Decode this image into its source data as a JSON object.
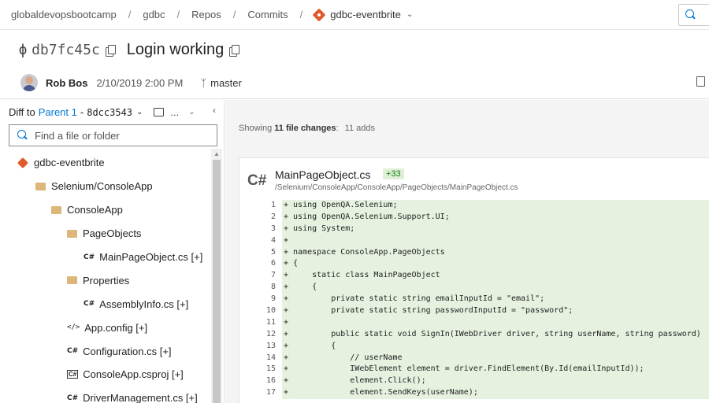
{
  "breadcrumb": {
    "items": [
      "globaldevopsbootcamp",
      "gdbc",
      "Repos",
      "Commits"
    ],
    "separator": "/",
    "repo": "gdbc-eventbrite"
  },
  "commit": {
    "hash": "db7fc45c",
    "title": "Login working",
    "author": "Rob Bos",
    "date": "2/10/2019 2:00 PM",
    "branch": "master"
  },
  "diff": {
    "prefix": "Diff to",
    "parent": "Parent 1",
    "dash": "-",
    "parent_hash": "8dcc3543",
    "more": "..."
  },
  "filter": {
    "placeholder": "Find a file or folder"
  },
  "tree": [
    {
      "label": "gdbc-eventbrite",
      "icon": "repo",
      "indent": 0
    },
    {
      "label": "Selenium/ConsoleApp",
      "icon": "folder",
      "indent": 1
    },
    {
      "label": "ConsoleApp",
      "icon": "folder",
      "indent": 2
    },
    {
      "label": "PageObjects",
      "icon": "folder",
      "indent": 3
    },
    {
      "label": "MainPageObject.cs [+]",
      "icon": "cs",
      "indent": 4
    },
    {
      "label": "Properties",
      "icon": "folder",
      "indent": 3
    },
    {
      "label": "AssemblyInfo.cs [+]",
      "icon": "cs",
      "indent": 4
    },
    {
      "label": "App.config [+]",
      "icon": "xml",
      "indent": 3
    },
    {
      "label": "Configuration.cs [+]",
      "icon": "cs",
      "indent": 3
    },
    {
      "label": "ConsoleApp.csproj [+]",
      "icon": "proj",
      "indent": 3
    },
    {
      "label": "DriverManagement.cs [+]",
      "icon": "cs",
      "indent": 3
    }
  ],
  "icons": {
    "cs": "C#",
    "xml": "</>",
    "proj": "C#"
  },
  "summary": {
    "prefix": "Showing",
    "count": "11 file changes",
    "adds": "11 adds"
  },
  "file": {
    "lang": "C#",
    "name": "MainPageObject.cs",
    "badge": "+33",
    "path": "/Selenium/ConsoleApp/ConsoleApp/PageObjects/MainPageObject.cs"
  },
  "code": [
    {
      "n": "1",
      "t": "+ using OpenQA.Selenium;"
    },
    {
      "n": "2",
      "t": "+ using OpenQA.Selenium.Support.UI;"
    },
    {
      "n": "3",
      "t": "+ using System;"
    },
    {
      "n": "4",
      "t": "+"
    },
    {
      "n": "5",
      "t": "+ namespace ConsoleApp.PageObjects"
    },
    {
      "n": "6",
      "t": "+ {"
    },
    {
      "n": "7",
      "t": "+     static class MainPageObject"
    },
    {
      "n": "8",
      "t": "+     {"
    },
    {
      "n": "9",
      "t": "+         private static string emailInputId = \"email\";"
    },
    {
      "n": "10",
      "t": "+         private static string passwordInputId = \"password\";"
    },
    {
      "n": "11",
      "t": "+"
    },
    {
      "n": "12",
      "t": "+         public static void SignIn(IWebDriver driver, string userName, string password)"
    },
    {
      "n": "13",
      "t": "+         {"
    },
    {
      "n": "14",
      "t": "+             // userName"
    },
    {
      "n": "15",
      "t": "+             IWebElement element = driver.FindElement(By.Id(emailInputId));"
    },
    {
      "n": "16",
      "t": "+             element.Click();"
    },
    {
      "n": "17",
      "t": "+             element.SendKeys(userName);"
    }
  ]
}
